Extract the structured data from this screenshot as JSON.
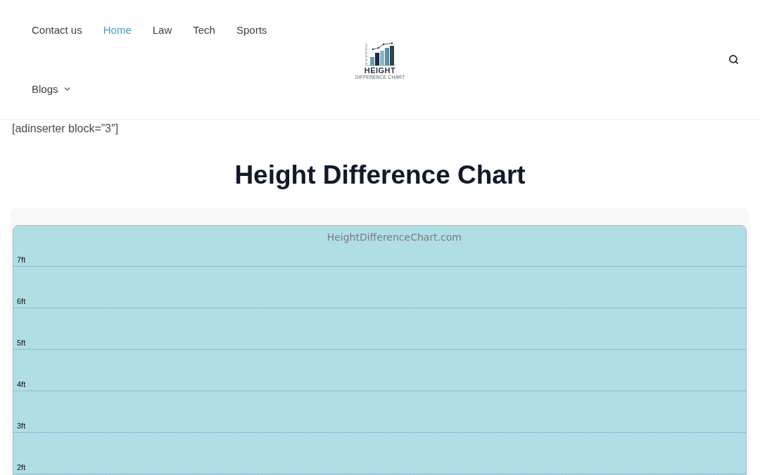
{
  "header": {
    "nav": [
      {
        "label": "Contact us",
        "selected": false,
        "dropdown": false
      },
      {
        "label": "Home",
        "selected": true,
        "dropdown": false
      },
      {
        "label": "Law",
        "selected": false,
        "dropdown": false
      },
      {
        "label": "Tech",
        "selected": false,
        "dropdown": false
      },
      {
        "label": "Sports",
        "selected": false,
        "dropdown": false
      },
      {
        "label": "Blogs",
        "selected": false,
        "dropdown": true
      }
    ],
    "logo": {
      "title": "HEIGHT",
      "subtitle": "DIFFERENCE CHART"
    }
  },
  "shortcode_text": "[adinserter block=”3″]",
  "page_title": "Height Difference Chart",
  "chart_panel": {
    "caption": "HeightDifferenceChart.com",
    "scale_labels": [
      "7ft",
      "6ft",
      "5ft",
      "4ft",
      "3ft",
      "2ft"
    ]
  }
}
